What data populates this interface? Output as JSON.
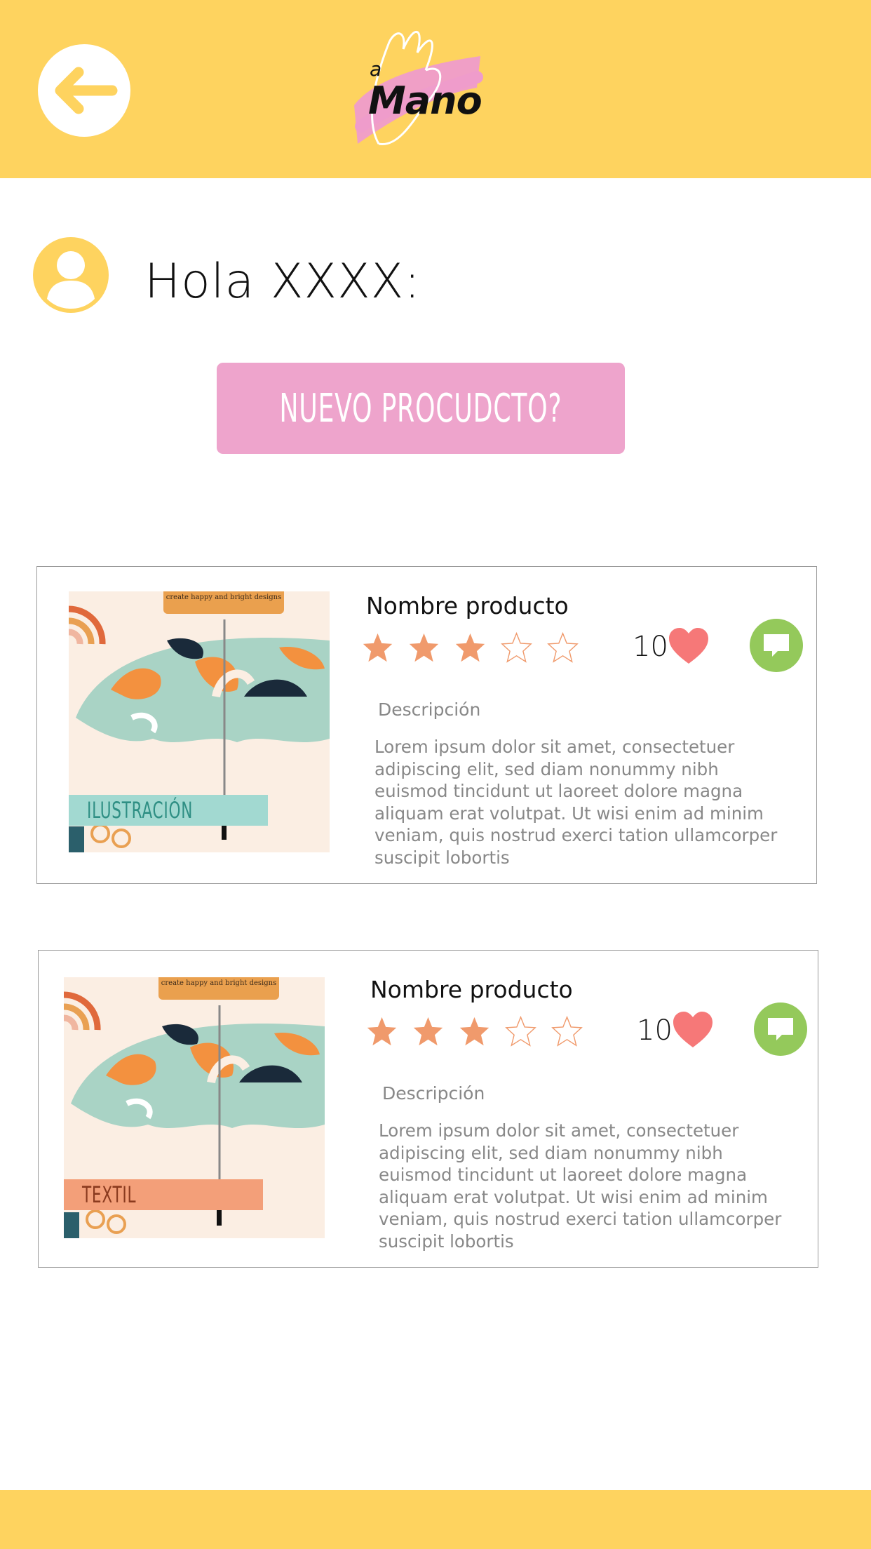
{
  "header": {
    "logo_small": "a",
    "logo_word": "Mano"
  },
  "greeting": "Hola XXXX:",
  "new_product_button": "NUEVO PROCUDCTO?",
  "products": [
    {
      "name": "Nombre producto",
      "rating": 3,
      "max_rating": 5,
      "likes": "10",
      "description_label": "Descripción",
      "description": "Lorem ipsum dolor sit amet, consectetuer adipiscing elit, sed diam nonummy nibh euismod tincidunt ut laoreet dolore magna aliquam erat volutpat. Ut wisi enim ad minim veniam, quis nostrud exerci tation ullamcorper suscipit lobortis",
      "image_promo": "create happy and bright designs",
      "tag": "ILUSTRACIÓN",
      "tag_color": "#a2d9d1",
      "tag_text_color": "#2f8f84"
    },
    {
      "name": "Nombre producto",
      "rating": 3,
      "max_rating": 5,
      "likes": "10",
      "description_label": "Descripción",
      "description": "Lorem ipsum dolor sit amet, consectetuer adipiscing elit, sed diam nonummy nibh euismod tincidunt ut laoreet dolore magna aliquam erat volutpat. Ut wisi enim ad minim veniam, quis nostrud exerci tation ullamcorper suscipit lobortis",
      "image_promo": "create happy and bright designs",
      "tag": "TEXTIL",
      "tag_color": "#f39f79",
      "tag_text_color": "#8a3a1e"
    }
  ],
  "colors": {
    "header_bg": "#fed35f",
    "button_pink": "#eea4cc",
    "star_fill": "#f09a6c",
    "heart": "#f67878",
    "chat_green": "#94c95b"
  },
  "icons": [
    "back-arrow-icon",
    "user-avatar-icon",
    "star-icon",
    "heart-icon",
    "chat-bubble-icon"
  ]
}
